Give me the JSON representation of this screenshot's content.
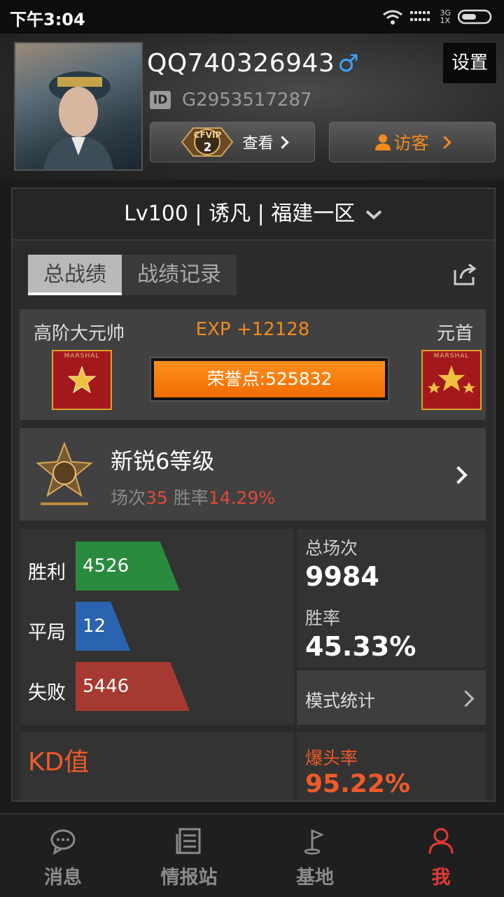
{
  "status_bar": {
    "time": "下午3:04",
    "network": "3G\n1X"
  },
  "profile": {
    "username": "QQ740326943",
    "gender_symbol": "♂",
    "id_label": "ID",
    "id_value": "G2953517287",
    "settings_label": "设置",
    "vip_badge": "CFVIP",
    "vip_level": "2",
    "vip_view_label": "查看",
    "visitor_label": "访客"
  },
  "server": {
    "text": "Lv100 | 诱凡 | 福建一区"
  },
  "tabs": [
    {
      "label": "总战绩",
      "active": true
    },
    {
      "label": "战绩记录",
      "active": false
    }
  ],
  "rank": {
    "current": "高阶大元帅",
    "next": "元首",
    "exp": "EXP +12128",
    "honor": "荣誉点:525832",
    "medal_text": "MARSHAL"
  },
  "level": {
    "title": "新锐6等级",
    "matches_label": "场次",
    "matches_value": "35",
    "winrate_label": "胜率",
    "winrate_value": "14.29%"
  },
  "results": [
    {
      "label": "胜利",
      "value": "4526",
      "count": 4526,
      "color": "#2a8a3e"
    },
    {
      "label": "平局",
      "value": "12",
      "count": 12,
      "color": "#2a63b0"
    },
    {
      "label": "失败",
      "value": "5446",
      "count": 5446,
      "color": "#a63a32"
    }
  ],
  "summary": {
    "total_label": "总场次",
    "total_value": "9984",
    "winrate_label": "胜率",
    "winrate_value": "45.33%",
    "mode_label": "模式统计"
  },
  "extra": {
    "kd_label": "KD值",
    "headshot_label": "爆头率",
    "headshot_value": "95.22%"
  },
  "nav": [
    {
      "label": "消息",
      "icon": "chat-icon",
      "active": false
    },
    {
      "label": "情报站",
      "icon": "news-icon",
      "active": false
    },
    {
      "label": "基地",
      "icon": "flag-icon",
      "active": false
    },
    {
      "label": "我",
      "icon": "person-icon",
      "active": true
    }
  ],
  "colors": {
    "accent_orange": "#f28a1e",
    "active_red": "#e53935",
    "male_blue": "#3aa3ff"
  }
}
